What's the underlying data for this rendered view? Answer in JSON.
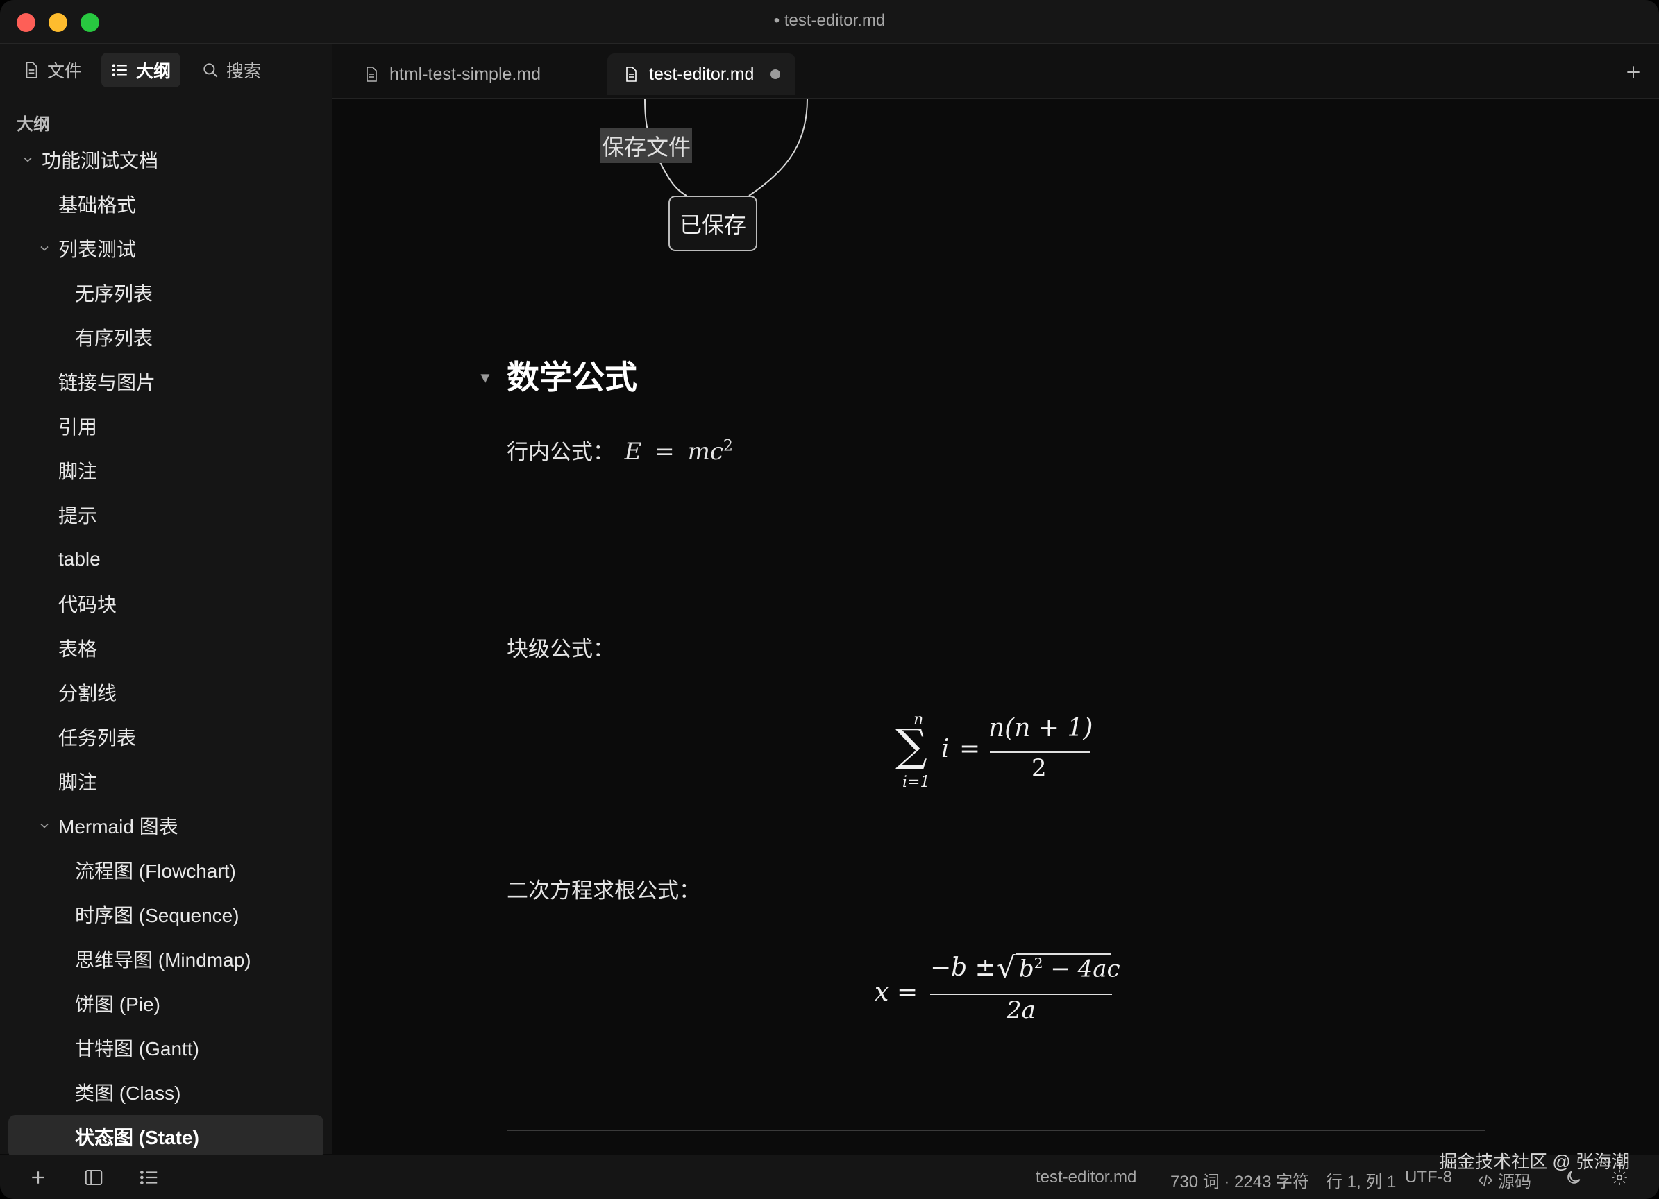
{
  "window": {
    "title": "• test-editor.md"
  },
  "sidebar": {
    "tabs": [
      {
        "label": "文件",
        "icon": "file-icon"
      },
      {
        "label": "大纲",
        "icon": "list-icon",
        "active": true
      },
      {
        "label": "搜索",
        "icon": "search-icon"
      }
    ],
    "outline_heading": "大纲",
    "outline": [
      {
        "label": "功能测试文档",
        "level": 1,
        "expanded": true
      },
      {
        "label": "基础格式",
        "level": 2
      },
      {
        "label": "列表测试",
        "level": 2,
        "expanded": true
      },
      {
        "label": "无序列表",
        "level": 3
      },
      {
        "label": "有序列表",
        "level": 3
      },
      {
        "label": "链接与图片",
        "level": 2
      },
      {
        "label": "引用",
        "level": 2
      },
      {
        "label": "脚注",
        "level": 2
      },
      {
        "label": "提示",
        "level": 2
      },
      {
        "label": "table",
        "level": 2
      },
      {
        "label": "代码块",
        "level": 2
      },
      {
        "label": "表格",
        "level": 2
      },
      {
        "label": "分割线",
        "level": 2
      },
      {
        "label": "任务列表",
        "level": 2
      },
      {
        "label": "脚注",
        "level": 2
      },
      {
        "label": "Mermaid 图表",
        "level": 2,
        "expanded": true
      },
      {
        "label": "流程图 (Flowchart)",
        "level": 3
      },
      {
        "label": "时序图 (Sequence)",
        "level": 3
      },
      {
        "label": "思维导图 (Mindmap)",
        "level": 3
      },
      {
        "label": "饼图 (Pie)",
        "level": 3
      },
      {
        "label": "甘特图 (Gantt)",
        "level": 3
      },
      {
        "label": "类图 (Class)",
        "level": 3
      },
      {
        "label": "状态图 (State)",
        "level": 3,
        "active": true
      }
    ]
  },
  "tabs": [
    {
      "label": "html-test-simple.md",
      "active": false
    },
    {
      "label": "test-editor.md",
      "active": true,
      "dirty": true
    }
  ],
  "editor": {
    "diagram_label": "保存文件",
    "diagram_state": "已保存",
    "heading": "数学公式",
    "inline_label": "行内公式：",
    "inline_formula": {
      "lhs": "E",
      "eq": "=",
      "rhs": "mc",
      "exp": "2"
    },
    "block_label": "块级公式：",
    "block_formula": {
      "sum_upper": "n",
      "sum_lower": "i=1",
      "sum_symbol": "∑",
      "term": "i",
      "eq": "=",
      "numerator": "n(n + 1)",
      "denominator": "2"
    },
    "quadratic_label": "二次方程求根公式：",
    "quadratic_formula": {
      "lhs": "x",
      "eq": "=",
      "num_prefix": "−b ±",
      "radicand_b": "b",
      "radicand_exp": "2",
      "radicand_rest": "− 4ac",
      "denominator": "2a"
    }
  },
  "status": {
    "filename": "test-editor.md",
    "counts": "730 词 · 2243 字符",
    "cursor": "行 1, 列 1",
    "encoding": "UTF-8",
    "source_label": "源码"
  },
  "watermark": "掘金技术社区 @ 张海潮"
}
